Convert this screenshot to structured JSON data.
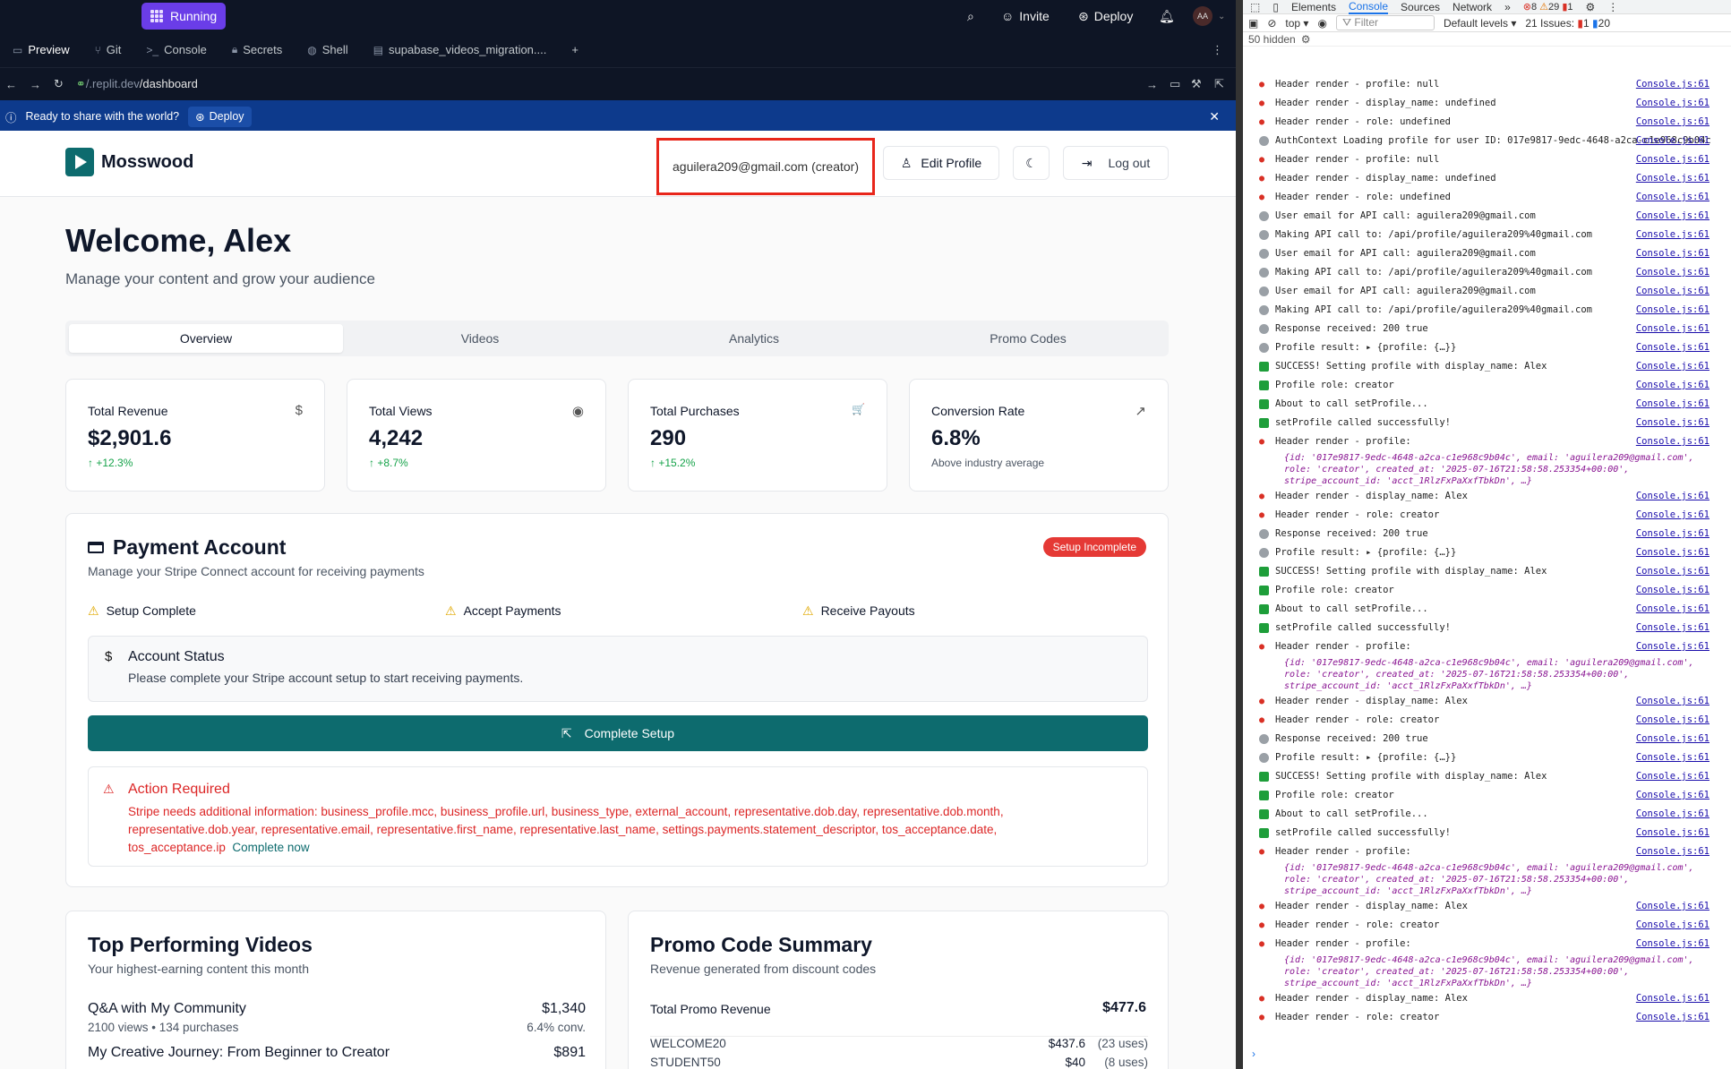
{
  "topbar": {
    "running_label": "Running",
    "invite_label": "Invite",
    "deploy_label": "Deploy",
    "avatar_initials": "AA"
  },
  "workspace_tabs": [
    {
      "label": "Preview",
      "icon": "monitor-icon"
    },
    {
      "label": "Git",
      "icon": "git-branch-icon"
    },
    {
      "label": "Console",
      "icon": "terminal-icon"
    },
    {
      "label": "Secrets",
      "icon": "lock-icon"
    },
    {
      "label": "Shell",
      "icon": "globe-icon"
    },
    {
      "label": "supabase_videos_migration....",
      "icon": "file-icon"
    }
  ],
  "url": {
    "prefix": "/.replit.dev",
    "path": "/dashboard"
  },
  "banner": {
    "text": "Ready to share with the world?",
    "deploy_label": "Deploy"
  },
  "app": {
    "brand": "Mosswood",
    "user": "aguilera209@gmail.com (creator)",
    "edit_profile": "Edit Profile",
    "logout": "Log out",
    "welcome": "Welcome, Alex",
    "subtitle": "Manage your content and grow your audience",
    "tabs": [
      "Overview",
      "Videos",
      "Analytics",
      "Promo Codes"
    ],
    "stats": [
      {
        "title": "Total Revenue",
        "value": "$2,901.6",
        "sub": "↑ +12.3%",
        "icon": "$",
        "green": true
      },
      {
        "title": "Total Views",
        "value": "4,242",
        "sub": "↑ +8.7%",
        "icon": "◉",
        "green": true
      },
      {
        "title": "Total Purchases",
        "value": "290",
        "sub": "↑ +15.2%",
        "icon": "🛒",
        "green": true
      },
      {
        "title": "Conversion Rate",
        "value": "6.8%",
        "sub": "Above industry average",
        "icon": "↗",
        "green": false
      }
    ],
    "payment": {
      "title": "Payment Account",
      "subtitle": "Manage your Stripe Connect account for receiving payments",
      "badge": "Setup Incomplete",
      "checks": [
        "Setup Complete",
        "Accept Payments",
        "Receive Payouts"
      ],
      "status_title": "Account Status",
      "status_text": "Please complete your Stripe account setup to start receiving payments.",
      "button": "Complete Setup",
      "action_title": "Action Required",
      "action_text": "Stripe needs additional information: business_profile.mcc, business_profile.url, business_type, external_account, representative.dob.day, representative.dob.month, representative.dob.year, representative.email, representative.first_name, representative.last_name, settings.payments.statement_descriptor, tos_acceptance.date, tos_acceptance.ip",
      "action_link": "Complete now"
    },
    "top_videos": {
      "title": "Top Performing Videos",
      "subtitle": "Your highest-earning content this month",
      "items": [
        {
          "name": "Q&A with My Community",
          "meta": "2100 views • 134 purchases",
          "amount": "$1,340",
          "conv": "6.4% conv."
        },
        {
          "name": "My Creative Journey: From Beginner to Creator",
          "meta": "",
          "amount": "$891",
          "conv": ""
        }
      ]
    },
    "promo": {
      "title": "Promo Code Summary",
      "subtitle": "Revenue generated from discount codes",
      "total_label": "Total Promo Revenue",
      "total_value": "$477.6",
      "items": [
        {
          "code": "WELCOME20",
          "amount": "$437.6",
          "uses": "(23 uses)"
        },
        {
          "code": "STUDENT50",
          "amount": "$40",
          "uses": "(8 uses)"
        }
      ]
    }
  },
  "devtools": {
    "tabs": [
      "Elements",
      "Console",
      "Sources",
      "Network"
    ],
    "errors": "8",
    "warnings": "29",
    "info": "1",
    "context": "top",
    "filter_placeholder": "Filter",
    "levels": "Default levels",
    "issues": "21 Issues:",
    "issues_err": "1",
    "issues_info": "20",
    "hidden": "50 hidden",
    "src": "Console.js:61",
    "logs": [
      {
        "t": "err",
        "m": "Header render - profile: null"
      },
      {
        "t": "err",
        "m": "Header render - display_name: undefined"
      },
      {
        "t": "err",
        "m": "Header render - role: undefined"
      },
      {
        "t": "info",
        "m": "AuthContext Loading profile for user ID: 017e9817-9edc-4648-a2ca-c1e968c9b04c"
      },
      {
        "t": "err",
        "m": "Header render - profile: null"
      },
      {
        "t": "err",
        "m": "Header render - display_name: undefined"
      },
      {
        "t": "err",
        "m": "Header render - role: undefined"
      },
      {
        "t": "info",
        "m": "User email for API call: aguilera209@gmail.com"
      },
      {
        "t": "info",
        "m": "Making API call to: /api/profile/aguilera209%40gmail.com"
      },
      {
        "t": "info",
        "m": "User email for API call: aguilera209@gmail.com"
      },
      {
        "t": "info",
        "m": "Making API call to: /api/profile/aguilera209%40gmail.com"
      },
      {
        "t": "info",
        "m": "User email for API call: aguilera209@gmail.com"
      },
      {
        "t": "info",
        "m": "Making API call to: /api/profile/aguilera209%40gmail.com"
      },
      {
        "t": "info",
        "m": "Response received: 200 true"
      },
      {
        "t": "info",
        "m": "Profile result:  ▸ {profile: {…}}"
      },
      {
        "t": "ok",
        "m": "SUCCESS! Setting profile with display_name: Alex"
      },
      {
        "t": "ok",
        "m": "Profile role: creator"
      },
      {
        "t": "ok",
        "m": "About to call setProfile..."
      },
      {
        "t": "ok",
        "m": "setProfile called successfully!"
      },
      {
        "t": "err",
        "m": "Header render - profile:"
      },
      {
        "t": "obj",
        "m": "{id: '017e9817-9edc-4648-a2ca-c1e968c9b04c', email: 'aguilera209@gmail.com', role: 'creator', created_at: '2025-07-16T21:58:58.253354+00:00', stripe_account_id: 'acct_1RlzFxPaXxfTbkDn', …}"
      },
      {
        "t": "err",
        "m": "Header render - display_name: Alex"
      },
      {
        "t": "err",
        "m": "Header render - role: creator"
      },
      {
        "t": "info",
        "m": "Response received: 200 true"
      },
      {
        "t": "info",
        "m": "Profile result:  ▸ {profile: {…}}"
      },
      {
        "t": "ok",
        "m": "SUCCESS! Setting profile with display_name: Alex"
      },
      {
        "t": "ok",
        "m": "Profile role: creator"
      },
      {
        "t": "ok",
        "m": "About to call setProfile..."
      },
      {
        "t": "ok",
        "m": "setProfile called successfully!"
      },
      {
        "t": "err",
        "m": "Header render - profile:"
      },
      {
        "t": "obj",
        "m": "{id: '017e9817-9edc-4648-a2ca-c1e968c9b04c', email: 'aguilera209@gmail.com', role: 'creator', created_at: '2025-07-16T21:58:58.253354+00:00', stripe_account_id: 'acct_1RlzFxPaXxfTbkDn', …}"
      },
      {
        "t": "err",
        "m": "Header render - display_name: Alex"
      },
      {
        "t": "err",
        "m": "Header render - role: creator"
      },
      {
        "t": "info",
        "m": "Response received: 200 true"
      },
      {
        "t": "info",
        "m": "Profile result:  ▸ {profile: {…}}"
      },
      {
        "t": "ok",
        "m": "SUCCESS! Setting profile with display_name: Alex"
      },
      {
        "t": "ok",
        "m": "Profile role: creator"
      },
      {
        "t": "ok",
        "m": "About to call setProfile..."
      },
      {
        "t": "ok",
        "m": "setProfile called successfully!"
      },
      {
        "t": "err",
        "m": "Header render - profile:"
      },
      {
        "t": "obj",
        "m": "{id: '017e9817-9edc-4648-a2ca-c1e968c9b04c', email: 'aguilera209@gmail.com', role: 'creator', created_at: '2025-07-16T21:58:58.253354+00:00', stripe_account_id: 'acct_1RlzFxPaXxfTbkDn', …}"
      },
      {
        "t": "err",
        "m": "Header render - display_name: Alex"
      },
      {
        "t": "err",
        "m": "Header render - role: creator"
      },
      {
        "t": "err",
        "m": "Header render - profile:"
      },
      {
        "t": "obj",
        "m": "{id: '017e9817-9edc-4648-a2ca-c1e968c9b04c', email: 'aguilera209@gmail.com', role: 'creator', created_at: '2025-07-16T21:58:58.253354+00:00', stripe_account_id: 'acct_1RlzFxPaXxfTbkDn', …}"
      },
      {
        "t": "err",
        "m": "Header render - display_name: Alex"
      },
      {
        "t": "err",
        "m": "Header render - role: creator"
      }
    ]
  }
}
